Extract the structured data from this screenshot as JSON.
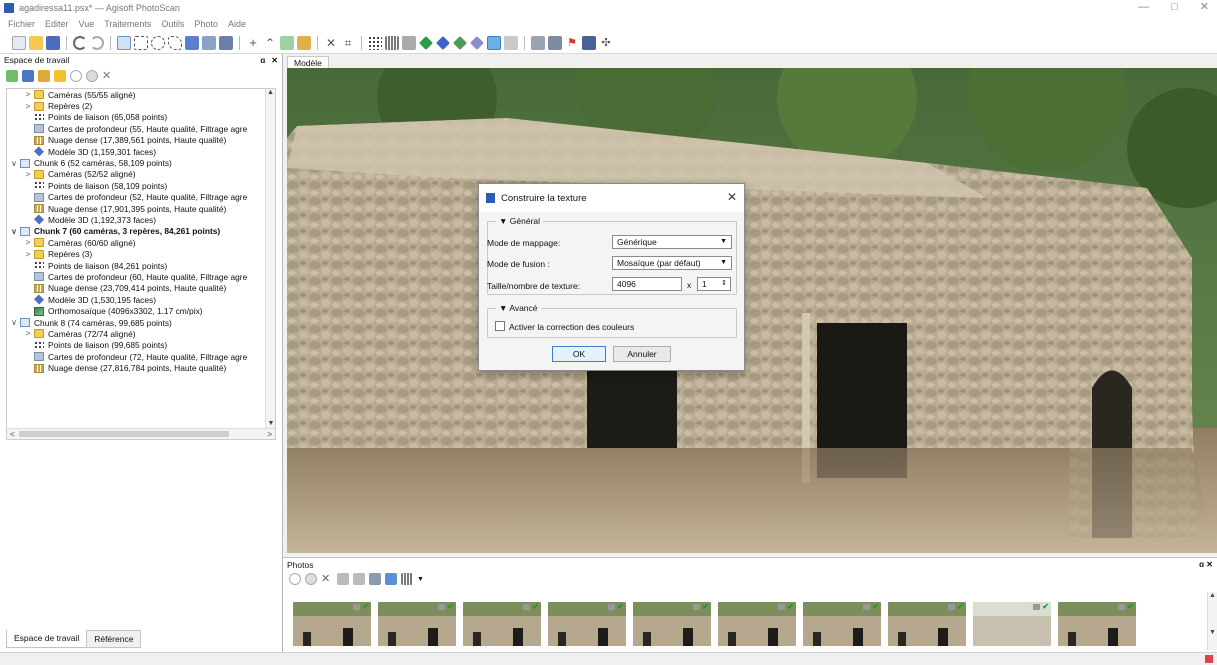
{
  "window": {
    "title": "agadiressa11.psx* — Agisoft PhotoScan",
    "controls": [
      "—",
      "□",
      "✕"
    ]
  },
  "menu": [
    "Fichier",
    "Editer",
    "Vue",
    "Traitements",
    "Outils",
    "Photo",
    "Aide"
  ],
  "workspace": {
    "title": "Espace de travail",
    "tree": [
      {
        "indent": 1,
        "arrow": ">",
        "icon": "folder",
        "label": "Caméras (55/55 aligné)",
        "bold": false
      },
      {
        "indent": 1,
        "arrow": ">",
        "icon": "folder",
        "label": "Repères (2)",
        "bold": false
      },
      {
        "indent": 1,
        "arrow": "",
        "icon": "dots",
        "label": "Points de liaison (65,058 points)",
        "bold": false
      },
      {
        "indent": 1,
        "arrow": "",
        "icon": "depth",
        "label": "Cartes de profondeur (55, Haute qualité, Filtrage agre",
        "bold": false
      },
      {
        "indent": 1,
        "arrow": "",
        "icon": "dense",
        "label": "Nuage dense (17,389,561 points, Haute qualité)",
        "bold": false
      },
      {
        "indent": 1,
        "arrow": "",
        "icon": "model",
        "label": "Modèle 3D (1,159,301 faces)",
        "bold": false
      },
      {
        "indent": 0,
        "arrow": "∨",
        "icon": "chunk",
        "label": "Chunk 6 (52 caméras, 58,109 points)",
        "bold": false
      },
      {
        "indent": 1,
        "arrow": ">",
        "icon": "folder",
        "label": "Caméras (52/52 aligné)",
        "bold": false
      },
      {
        "indent": 1,
        "arrow": "",
        "icon": "dots",
        "label": "Points de liaison (58,109 points)",
        "bold": false
      },
      {
        "indent": 1,
        "arrow": "",
        "icon": "depth",
        "label": "Cartes de profondeur (52, Haute qualité, Filtrage agre",
        "bold": false
      },
      {
        "indent": 1,
        "arrow": "",
        "icon": "dense",
        "label": "Nuage dense (17,901,395 points, Haute qualité)",
        "bold": false
      },
      {
        "indent": 1,
        "arrow": "",
        "icon": "model",
        "label": "Modèle 3D (1,192,373 faces)",
        "bold": false
      },
      {
        "indent": 0,
        "arrow": "∨",
        "icon": "chunk",
        "label": "Chunk 7 (60 caméras, 3 repères, 84,261 points)",
        "bold": true
      },
      {
        "indent": 1,
        "arrow": ">",
        "icon": "folder",
        "label": "Caméras (60/60 aligné)",
        "bold": false
      },
      {
        "indent": 1,
        "arrow": ">",
        "icon": "folder",
        "label": "Repères (3)",
        "bold": false
      },
      {
        "indent": 1,
        "arrow": "",
        "icon": "dots",
        "label": "Points de liaison (84,261 points)",
        "bold": false
      },
      {
        "indent": 1,
        "arrow": "",
        "icon": "depth",
        "label": "Cartes de profondeur (60, Haute qualité, Filtrage agre",
        "bold": false
      },
      {
        "indent": 1,
        "arrow": "",
        "icon": "dense",
        "label": "Nuage dense (23,709,414 points, Haute qualité)",
        "bold": false
      },
      {
        "indent": 1,
        "arrow": "",
        "icon": "model",
        "label": "Modèle 3D (1,530,195 faces)",
        "bold": false
      },
      {
        "indent": 1,
        "arrow": "",
        "icon": "ortho",
        "label": "Orthomosaïque (4096x3302, 1.17 cm/pix)",
        "bold": false
      },
      {
        "indent": 0,
        "arrow": "∨",
        "icon": "chunk",
        "label": "Chunk 8 (74 caméras, 99,685 points)",
        "bold": false
      },
      {
        "indent": 1,
        "arrow": ">",
        "icon": "folder",
        "label": "Caméras (72/74 aligné)",
        "bold": false
      },
      {
        "indent": 1,
        "arrow": "",
        "icon": "dots",
        "label": "Points de liaison (99,685 points)",
        "bold": false
      },
      {
        "indent": 1,
        "arrow": "",
        "icon": "depth",
        "label": "Cartes de profondeur (72, Haute qualité, Filtrage agre",
        "bold": false
      },
      {
        "indent": 1,
        "arrow": "",
        "icon": "dense",
        "label": "Nuage dense (27,816,784 points, Haute qualité)",
        "bold": false
      }
    ],
    "tabs": [
      "Espace de travail",
      "Référence"
    ]
  },
  "model_tab": "Modèle",
  "photos": {
    "title": "Photos",
    "count": 10
  },
  "dialog": {
    "title": "Construire la texture",
    "general_label": "Général",
    "mapping_label": "Mode de mappage:",
    "mapping_value": "Générique",
    "blending_label": "Mode de fusion :",
    "blending_value": "Mosaïque (par défaut)",
    "size_label": "Taille/nombre de texture:",
    "size_value": "4096",
    "count_value": "1",
    "times": "x",
    "advanced_label": "Avancé",
    "color_correction_label": "Activer la correction des couleurs",
    "color_correction_checked": false,
    "ok": "OK",
    "cancel": "Annuler"
  }
}
